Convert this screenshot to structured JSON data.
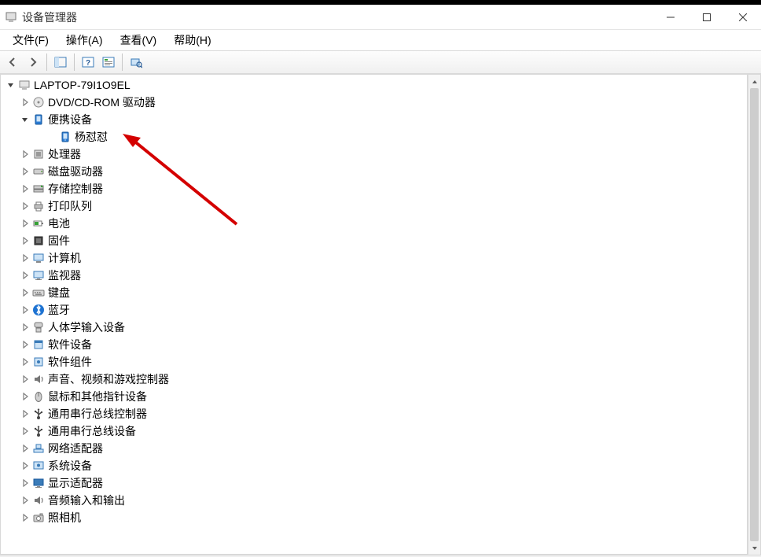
{
  "window": {
    "title": "设备管理器"
  },
  "menu": {
    "file": "文件(F)",
    "action": "操作(A)",
    "view": "查看(V)",
    "help": "帮助(H)"
  },
  "toolbar": {
    "back": "back",
    "forward": "forward",
    "showhide": "show-hide-console-tree",
    "help": "help",
    "properties": "properties",
    "scan": "scan-for-hardware-changes"
  },
  "tree": {
    "root": {
      "label": "LAPTOP-79I1O9EL",
      "expanded": true
    },
    "items": [
      {
        "label": "DVD/CD-ROM 驱动器",
        "icon": "disc",
        "collapsible": true
      },
      {
        "label": "便携设备",
        "icon": "device",
        "collapsible": true,
        "expanded": true,
        "children": [
          {
            "label": "杨怼怼",
            "icon": "phone"
          }
        ]
      },
      {
        "label": "处理器",
        "icon": "cpu",
        "collapsible": true
      },
      {
        "label": "磁盘驱动器",
        "icon": "disk",
        "collapsible": true
      },
      {
        "label": "存储控制器",
        "icon": "storage",
        "collapsible": true
      },
      {
        "label": "打印队列",
        "icon": "printer",
        "collapsible": true
      },
      {
        "label": "电池",
        "icon": "battery",
        "collapsible": true
      },
      {
        "label": "固件",
        "icon": "firmware",
        "collapsible": true
      },
      {
        "label": "计算机",
        "icon": "computer",
        "collapsible": true
      },
      {
        "label": "监视器",
        "icon": "monitor",
        "collapsible": true
      },
      {
        "label": "键盘",
        "icon": "keyboard",
        "collapsible": true
      },
      {
        "label": "蓝牙",
        "icon": "bluetooth",
        "collapsible": true
      },
      {
        "label": "人体学输入设备",
        "icon": "hid",
        "collapsible": true
      },
      {
        "label": "软件设备",
        "icon": "software",
        "collapsible": true
      },
      {
        "label": "软件组件",
        "icon": "component",
        "collapsible": true
      },
      {
        "label": "声音、视频和游戏控制器",
        "icon": "audio",
        "collapsible": true
      },
      {
        "label": "鼠标和其他指针设备",
        "icon": "mouse",
        "collapsible": true
      },
      {
        "label": "通用串行总线控制器",
        "icon": "usb",
        "collapsible": true
      },
      {
        "label": "通用串行总线设备",
        "icon": "usbdev",
        "collapsible": true
      },
      {
        "label": "网络适配器",
        "icon": "network",
        "collapsible": true
      },
      {
        "label": "系统设备",
        "icon": "system",
        "collapsible": true
      },
      {
        "label": "显示适配器",
        "icon": "display",
        "collapsible": true
      },
      {
        "label": "音频输入和输出",
        "icon": "audio",
        "collapsible": true
      },
      {
        "label": "照相机",
        "icon": "camera",
        "collapsible": true
      }
    ]
  }
}
